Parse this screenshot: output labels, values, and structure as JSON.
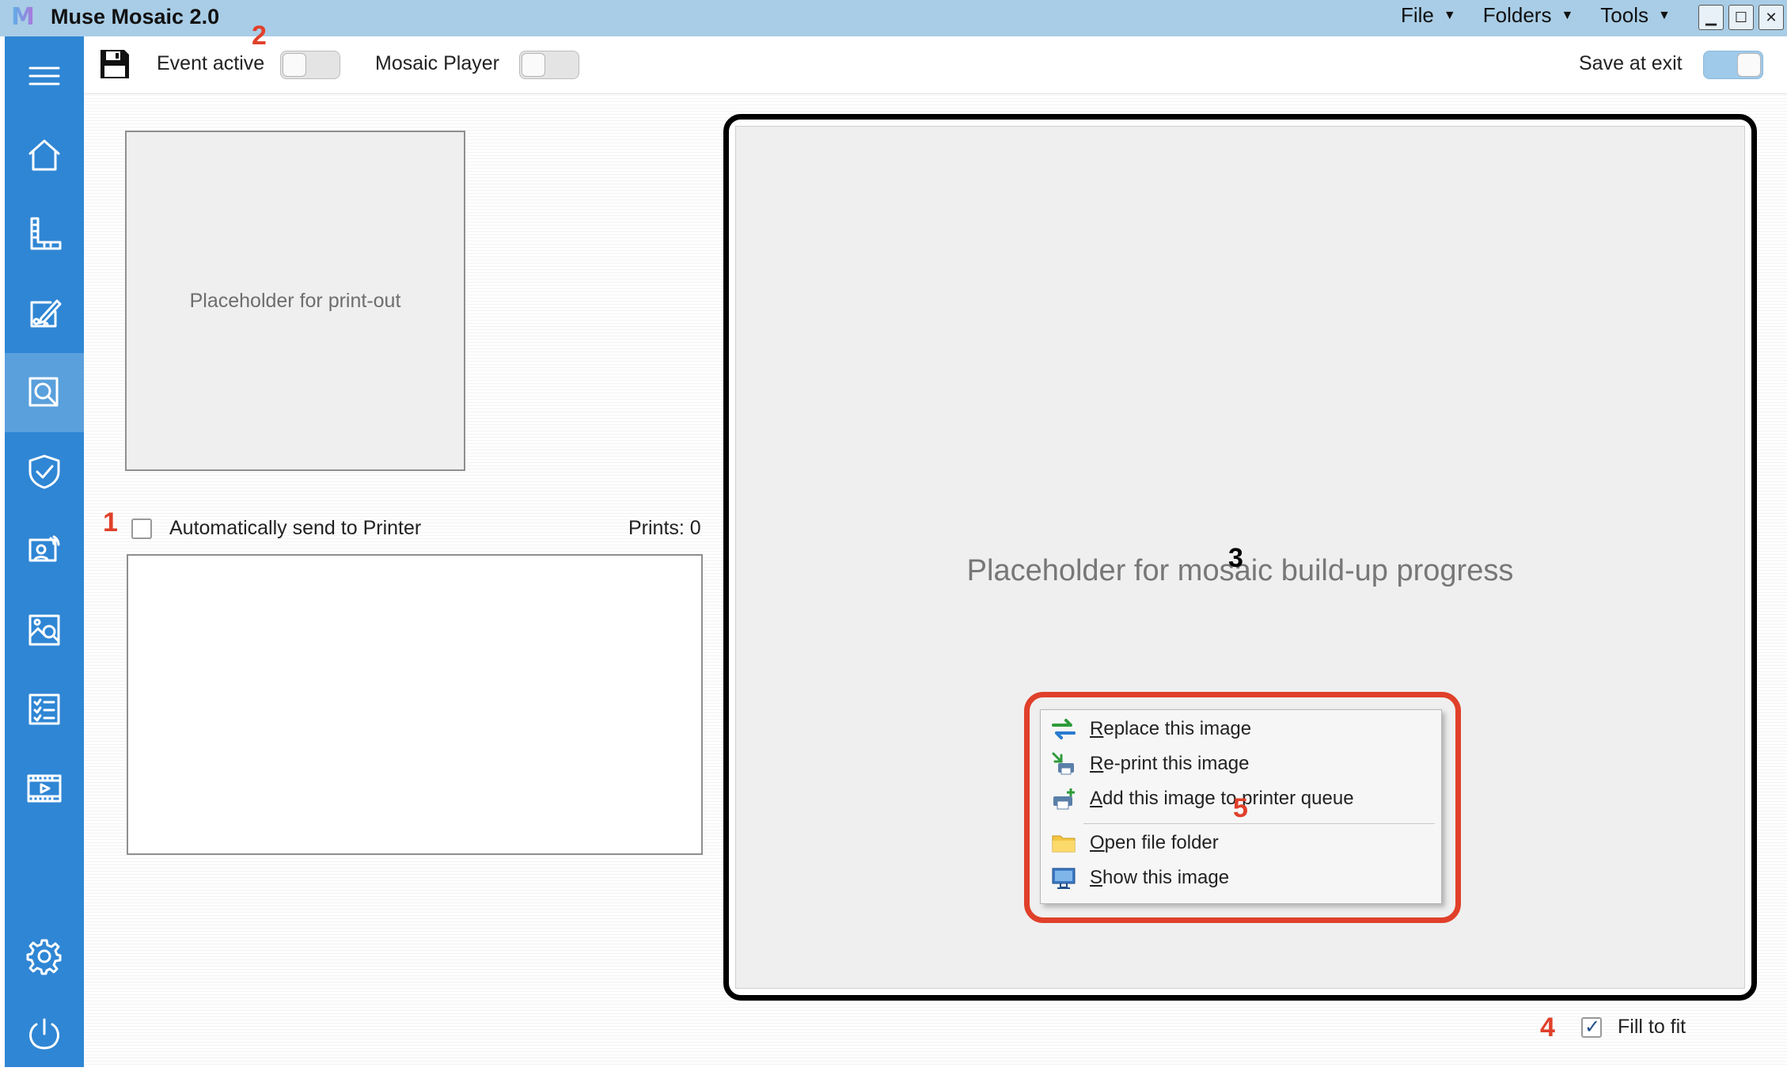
{
  "titlebar": {
    "logo": "M",
    "title": "Muse Mosaic 2.0",
    "menus": [
      {
        "label": "File"
      },
      {
        "label": "Folders"
      },
      {
        "label": "Tools"
      }
    ],
    "window_controls": {
      "minimize": "▁",
      "maximize": "☐",
      "close": "✕"
    }
  },
  "sidebar": {
    "items": [
      {
        "name": "menu",
        "icon": "hamburger-icon"
      },
      {
        "name": "home",
        "icon": "home-icon"
      },
      {
        "name": "measure",
        "icon": "ruler-icon"
      },
      {
        "name": "edit-design",
        "icon": "edit-palette-icon"
      },
      {
        "name": "inspect",
        "icon": "magnifier-icon",
        "active": true
      },
      {
        "name": "security",
        "icon": "shield-check-icon"
      },
      {
        "name": "presenter",
        "icon": "presenter-screen-icon"
      },
      {
        "name": "gallery",
        "icon": "image-search-icon"
      },
      {
        "name": "checklist",
        "icon": "checklist-icon"
      },
      {
        "name": "video",
        "icon": "film-icon"
      },
      {
        "name": "settings",
        "icon": "gear-icon"
      },
      {
        "name": "power",
        "icon": "power-icon"
      }
    ]
  },
  "toolbar": {
    "event_active_label": "Event active",
    "event_active_on": false,
    "mosaic_player_label": "Mosaic Player",
    "mosaic_player_on": false,
    "save_at_exit_label": "Save at exit",
    "save_at_exit_on": true
  },
  "left_panel": {
    "printout_placeholder": "Placeholder for print-out",
    "auto_send_label": "Automatically send to Printer",
    "auto_send_checked": false,
    "prints_label": "Prints: 0"
  },
  "mosaic_panel": {
    "placeholder": "Placeholder for mosaic build-up progress",
    "fill_to_fit_label": "Fill to fit",
    "fill_to_fit_checked": true
  },
  "context_menu": {
    "items": [
      {
        "mnemonic": "R",
        "rest": "eplace this image",
        "icon": "replace-arrows-icon"
      },
      {
        "mnemonic": "R",
        "rest": "e-print this image",
        "icon": "reprint-icon"
      },
      {
        "mnemonic": "A",
        "rest": "dd this image to printer queue",
        "icon": "printer-add-icon"
      },
      {
        "mnemonic": "O",
        "rest": "pen file folder",
        "icon": "folder-icon"
      },
      {
        "mnemonic": "S",
        "rest": "how this image",
        "icon": "monitor-icon"
      }
    ]
  },
  "annotations": {
    "a1": "1",
    "a2": "2",
    "a3": "3",
    "a4": "4",
    "a5": "5"
  },
  "colors": {
    "sidebar": "#2f86d4",
    "sidebar_active": "#5aa0dc",
    "titlebar": "#a9cde6",
    "annotation_red": "#e0402a"
  }
}
